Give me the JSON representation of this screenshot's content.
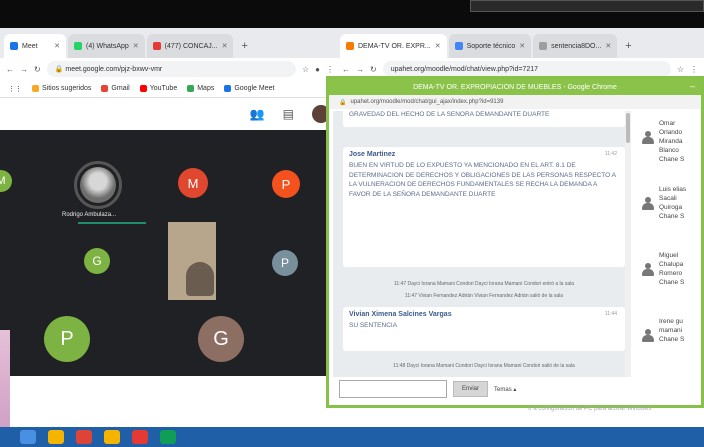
{
  "left_window": {
    "tabs": [
      {
        "label": "Meet",
        "fav_color": "#1a73e8"
      },
      {
        "label": "(4) WhatsApp",
        "fav_color": "#25d366"
      },
      {
        "label": "(477) CONCAJ...",
        "fav_color": "#e53935"
      }
    ],
    "url": "meet.google.com/pjz-bxwv-vmr",
    "bookmarks": [
      {
        "label": "Sitios sugeridos",
        "color": "#f9a825"
      },
      {
        "label": "Gmail",
        "color": "#ea4335"
      },
      {
        "label": "YouTube",
        "color": "#ff0000"
      },
      {
        "label": "Maps",
        "color": "#34a853"
      },
      {
        "label": "Google Meet",
        "color": "#1a73e8"
      }
    ],
    "meet": {
      "participants": [
        {
          "initial": "M",
          "color": "#e0472f"
        },
        {
          "initial": "P",
          "color": "#f4511e"
        },
        {
          "initial": "G",
          "color": "#7cb342"
        },
        {
          "initial": "P",
          "color": "#78909c"
        },
        {
          "initial": "P",
          "color": "#7cb342"
        },
        {
          "initial": "G",
          "color": "#8d6e63"
        },
        {
          "initial": "M",
          "color": "#7cb342"
        }
      ],
      "speaker_name": "Rodrigo Ambulaza..."
    }
  },
  "right_window": {
    "tabs": [
      "DEMA-TV OR. EXPR...",
      "Soporte técnico",
      "sentencia8DO..."
    ],
    "url": "upahet.org/moodle/mod/chat/view.php?id=7217"
  },
  "popup": {
    "title": "DEMA-TV OR. EXPROPIACION DE MUEBLES - Google Chrome",
    "url": "upahet.org/moodle/mod/chat/gui_ajax/index.php?id=9139",
    "truncated_top": "GRAVEDAD DEL HECHO DE LA SEÑORA DEMANDANTE DUARTE",
    "messages": [
      {
        "author": "Jose Martinez",
        "time": "11:42",
        "text": "BUEN EN VIRTUD DE LO EXPUESTO YA MENCIONADO EN EL ART. 8.1 DE DETERMINACION DE DERECHOS Y OBLIGACIONES DE LAS PERSONAS RESPECTO A LA VULNERACION DE DERECHOS FUNDAMENTALES SE RECHA LA DEMANDA A FAVOR DE LA SEÑORA DEMANDANTE DUARTE"
      },
      {
        "author": "Vivian Ximena Salcines Vargas",
        "time": "11:44",
        "text": "SU SENTENCIA"
      }
    ],
    "system_messages": [
      "11:47 Dayci Iorana Mamani Condori Dayci Iorana Mamani Condori entró a la sala",
      "11:47 Vivian Fernandez Adrián Vivian Fernandez Adrián salió de la sala",
      "11:48 Dayci Iorana Mamani Condori Dayci Iorana Mamani Condori salió de la sala"
    ],
    "users": [
      {
        "name": "Omar Orlando Miranda Blanco Chane S"
      },
      {
        "name": "Luis elias Sacali Quiroga Chane S"
      },
      {
        "name": "Miguel Chalupa Romero Chane S"
      },
      {
        "name": "Irene gu mamani Chane S"
      }
    ],
    "send_label": "Enviar",
    "themes_label": "Temas",
    "themes_arrow": "▴"
  },
  "hint_text": "Ir a configuración de PC para activar Windows",
  "taskbar_colors": [
    "#4a90e2",
    "#f4b400",
    "#db4437",
    "#f4b400",
    "#e53935",
    "#0f9d58"
  ]
}
